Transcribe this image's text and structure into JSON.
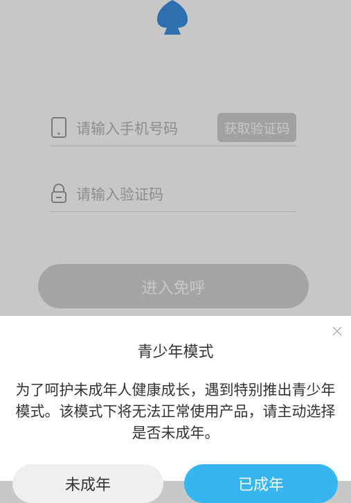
{
  "login": {
    "phone_placeholder": "请输入手机号码",
    "get_code_label": "获取验证码",
    "code_placeholder": "请输入验证码",
    "enter_label": "进入免呼"
  },
  "youth_mode_dialog": {
    "title": "青少年模式",
    "message": "为了呵护未成年人健康成长，遇到特别推出青少年模式。该模式下将无法正常使用产品，请主动选择是否未成年。",
    "minor_button_label": "未成年",
    "adult_button_label": "已成年"
  },
  "icons": {
    "logo": "app-logo-icon",
    "phone": "phone-icon",
    "lock": "lock-icon",
    "close": "close-icon"
  },
  "colors": {
    "accent": "#36b5f0",
    "logo": "#3a8fe0",
    "dim_overlay": "rgba(0,0,0,0.22)"
  }
}
